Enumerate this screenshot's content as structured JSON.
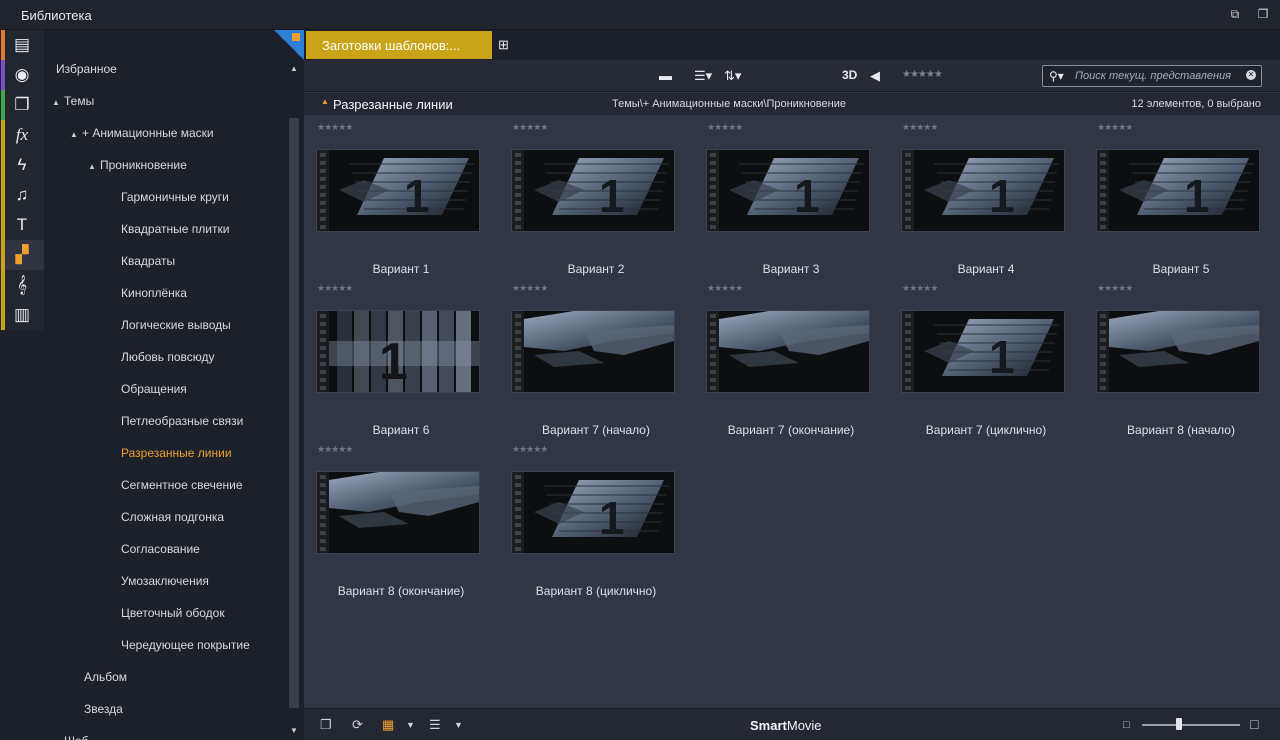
{
  "window": {
    "title": "Библиотека"
  },
  "strip": {
    "icons": [
      {
        "name": "media-icon",
        "glyph": "▤",
        "color": "#e07b2a"
      },
      {
        "name": "projects-icon",
        "glyph": "◉",
        "color": "#7c4fcf"
      },
      {
        "name": "collections-icon",
        "glyph": "❐",
        "color": "#3fa84a"
      },
      {
        "name": "effects-icon",
        "glyph": "fx",
        "color": "#c9a418"
      },
      {
        "name": "transitions-icon",
        "glyph": "ϟ",
        "color": "#c9a418"
      },
      {
        "name": "music-icon",
        "glyph": "♫",
        "color": "#c9a418"
      },
      {
        "name": "titles-icon",
        "glyph": "T",
        "color": "#c9a418"
      },
      {
        "name": "templates-icon",
        "glyph": "▞",
        "color": "#c9a418"
      },
      {
        "name": "sound-icon",
        "glyph": "𝄞",
        "color": "#c9a418"
      },
      {
        "name": "menus-icon",
        "glyph": "▥",
        "color": "#c9a418"
      }
    ],
    "selected": 7
  },
  "tree": {
    "nodes": [
      {
        "label": "Избранное",
        "level": 0,
        "arrow": "",
        "selected": false
      },
      {
        "label": "Темы",
        "level": 0,
        "arrow": "▲",
        "selected": false
      },
      {
        "label": "+ Анимационные маски",
        "level": 1,
        "arrow": "▲",
        "selected": false
      },
      {
        "label": "Проникновение",
        "level": 2,
        "arrow": "▲",
        "selected": false
      },
      {
        "label": "Гармоничные круги",
        "level": 3,
        "arrow": "",
        "selected": false
      },
      {
        "label": "Квадратные плитки",
        "level": 3,
        "arrow": "",
        "selected": false
      },
      {
        "label": "Квадраты",
        "level": 3,
        "arrow": "",
        "selected": false
      },
      {
        "label": "Киноплёнка",
        "level": 3,
        "arrow": "",
        "selected": false
      },
      {
        "label": "Логические выводы",
        "level": 3,
        "arrow": "",
        "selected": false
      },
      {
        "label": "Любовь повсюду",
        "level": 3,
        "arrow": "",
        "selected": false
      },
      {
        "label": "Обращения",
        "level": 3,
        "arrow": "",
        "selected": false
      },
      {
        "label": "Петлеобразные связи",
        "level": 3,
        "arrow": "",
        "selected": false
      },
      {
        "label": "Разрезанные линии",
        "level": 3,
        "arrow": "",
        "selected": true
      },
      {
        "label": "Сегментное свечение",
        "level": 3,
        "arrow": "",
        "selected": false
      },
      {
        "label": "Сложная подгонка",
        "level": 3,
        "arrow": "",
        "selected": false
      },
      {
        "label": "Согласование",
        "level": 3,
        "arrow": "",
        "selected": false
      },
      {
        "label": "Умозаключения",
        "level": 3,
        "arrow": "",
        "selected": false
      },
      {
        "label": "Цветочный ободок",
        "level": 3,
        "arrow": "",
        "selected": false
      },
      {
        "label": "Чередующее покрытие",
        "level": 3,
        "arrow": "",
        "selected": false
      },
      {
        "label": "Альбом",
        "level": 1,
        "arrow": "",
        "selected": false
      },
      {
        "label": "Звезда",
        "level": 1,
        "arrow": "",
        "selected": false
      },
      {
        "label": "Шаб...",
        "level": 0,
        "arrow": "▶",
        "selected": false
      }
    ]
  },
  "tab": {
    "label": "Заготовки шаблонов:..."
  },
  "toolbar": {
    "folder_icon": "folder-icon",
    "list_icon": "list-view-icon",
    "sort_icon": "sort-icon",
    "label_3d": "3D",
    "tag_icon": "tag-icon",
    "stars": "★★★★★",
    "search_placeholder": "Поиск текущ. представления"
  },
  "info": {
    "name": "Разрезанные линии",
    "path": "Темы\\+ Анимационные маски\\Проникновение",
    "count": "12 элементов, 0 выбрано"
  },
  "items": [
    {
      "label": "Вариант 1",
      "stars": "★★★★★",
      "art": "slats"
    },
    {
      "label": "Вариант 2",
      "stars": "★★★★★",
      "art": "slats"
    },
    {
      "label": "Вариант 3",
      "stars": "★★★★★",
      "art": "slats"
    },
    {
      "label": "Вариант 4",
      "stars": "★★★★★",
      "art": "slats"
    },
    {
      "label": "Вариант 5",
      "stars": "★★★★★",
      "art": "slats"
    },
    {
      "label": "Вариант 6",
      "stars": "★★★★★",
      "art": "vertical"
    },
    {
      "label": "Вариант 7 (начало)",
      "stars": "★★★★★",
      "art": "partial"
    },
    {
      "label": "Вариант 7 (окончание)",
      "stars": "★★★★★",
      "art": "partial"
    },
    {
      "label": "Вариант 7 (циклично)",
      "stars": "★★★★★",
      "art": "slats"
    },
    {
      "label": "Вариант 8 (начало)",
      "stars": "★★★★★",
      "art": "partial"
    },
    {
      "label": "Вариант 8 (окончание)",
      "stars": "★★★★★",
      "art": "partial"
    },
    {
      "label": "Вариант 8 (циклично)",
      "stars": "★★★★★",
      "art": "slats"
    }
  ],
  "thumb_numeral": "1",
  "bottom": {
    "brand_bold": "Smart",
    "brand_rest": "Movie",
    "zoom_level": 0.38
  }
}
